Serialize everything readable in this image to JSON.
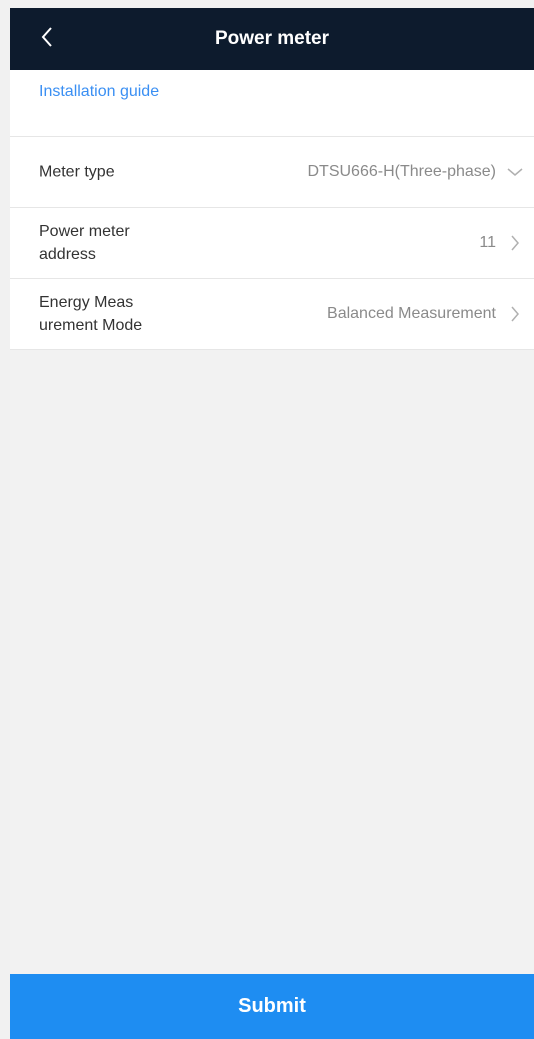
{
  "header": {
    "title": "Power meter",
    "back_icon": "chevron-left-icon"
  },
  "guide": {
    "label": "Installation guide"
  },
  "rows": [
    {
      "label": "Meter type",
      "value": "DTSU666-H(Three-phase)",
      "icon": "chevron-down-icon"
    },
    {
      "label": "Power meter address",
      "value": "11",
      "icon": "chevron-right-icon"
    },
    {
      "label": "Energy Meas urement Mode",
      "value": "Balanced Measurement",
      "icon": "chevron-right-icon"
    }
  ],
  "footer": {
    "submit_label": "Submit"
  },
  "colors": {
    "header_bg": "#0d1b2d",
    "link": "#3a8ff3",
    "submit_bg": "#1e8df2",
    "page_bg": "#f2f2f2"
  }
}
